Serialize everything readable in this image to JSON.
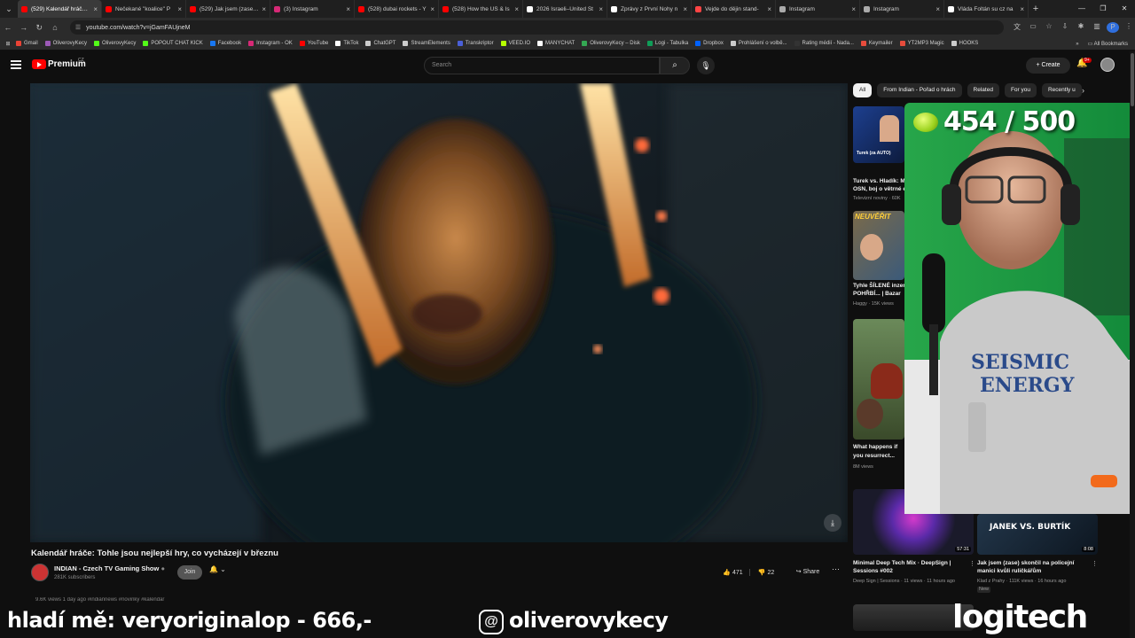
{
  "browser": {
    "tabs": [
      {
        "title": "(529) Kalendář hráče: T",
        "icon": "youtube-icon",
        "color": "#ff0000",
        "active": true
      },
      {
        "title": "Nečekané \"koalice\" P",
        "icon": "youtube-icon",
        "color": "#ff0000"
      },
      {
        "title": "(529) Jak jsem (zase) s",
        "icon": "youtube-icon",
        "color": "#ff0000"
      },
      {
        "title": "(3) Instagram",
        "icon": "instagram-icon",
        "color": "#d62976"
      },
      {
        "title": "(528) dubai rockets - Y",
        "icon": "youtube-icon",
        "color": "#ff0000"
      },
      {
        "title": "(528) How the US & Is",
        "icon": "youtube-icon",
        "color": "#ff0000"
      },
      {
        "title": "2026 Israeli–United St",
        "icon": "wikipedia-icon",
        "color": "#ffffff"
      },
      {
        "title": "Zprávy z První Nohy n",
        "icon": "x-icon",
        "color": "#ffffff"
      },
      {
        "title": "Vejde do dějin stand-",
        "icon": "news-icon",
        "color": "#ff4444"
      },
      {
        "title": "Instagram",
        "icon": "globe-icon",
        "color": "#aaaaaa"
      },
      {
        "title": "Instagram",
        "icon": "globe-icon",
        "color": "#aaaaaa"
      },
      {
        "title": "Vláda Foltán su cz na",
        "icon": "x-icon",
        "color": "#ffffff"
      }
    ],
    "url": "youtube.com/watch?v=jGamFAUjneM",
    "profile_initial": "P",
    "bookmarks": [
      {
        "label": "Gmail",
        "color": "#ea4335"
      },
      {
        "label": "OliverovyKecy",
        "color": "#9b59b6"
      },
      {
        "label": "OliverovyKecy",
        "color": "#53fc18"
      },
      {
        "label": "POPOUT CHAT KICK",
        "color": "#53fc18"
      },
      {
        "label": "Facebook",
        "color": "#1877f2"
      },
      {
        "label": "Instagram - OK",
        "color": "#d62976"
      },
      {
        "label": "YouTube",
        "color": "#ff0000"
      },
      {
        "label": "TikTok",
        "color": "#ffffff"
      },
      {
        "label": "ChatGPT",
        "color": "#cccccc"
      },
      {
        "label": "StreamElements",
        "color": "#cccccc"
      },
      {
        "label": "Transkriptor",
        "color": "#4a5fd8"
      },
      {
        "label": "VEED.IO",
        "color": "#b6ff00"
      },
      {
        "label": "MANYCHAT",
        "color": "#ffffff"
      },
      {
        "label": "OliverovyKecy – Disk",
        "color": "#34a853"
      },
      {
        "label": "Logi - Tabulka",
        "color": "#0f9d58"
      },
      {
        "label": "Dropbox",
        "color": "#0061ff"
      },
      {
        "label": "Prohlášení o volbě...",
        "color": "#cccccc"
      },
      {
        "label": "Rating médií - Nada...",
        "color": "#333333"
      },
      {
        "label": "Keymailer",
        "color": "#e74c3c"
      },
      {
        "label": "YT2MP3 Magic",
        "color": "#e74c3c"
      },
      {
        "label": "HOOKS",
        "color": "#cccccc"
      }
    ],
    "all_bookmarks": "All Bookmarks"
  },
  "masthead": {
    "brand": "Premium",
    "region": "CZ",
    "search_placeholder": "Search",
    "create": "Create",
    "notif_count": "9+"
  },
  "video": {
    "title": "Kalendář hráče: Tohle jsou nejlepší hry, co vycházejí v březnu",
    "channel": "INDIAN - Czech TV Gaming Show",
    "subscribers": "281K subscribers",
    "join": "Join",
    "likes": "471",
    "dislikes": "22",
    "share": "Share",
    "views_line": "9.6K views  1 day ago  #indiannews #novinky #kalendar"
  },
  "sidebar": {
    "chips": [
      "All",
      "From Indian - Pořad o hrách",
      "Related",
      "For you",
      "Recently u"
    ],
    "items": [
      {
        "title": "Turek vs. Hladík: M",
        "title2": "OSN, boj o větrné e",
        "meta": "Televizní noviny · 60K",
        "thumb_text": "Turek (za AUTO)"
      },
      {
        "title": "Tyhle ŠÍLENÉ inzer",
        "title2": "POHŘBÍ... | Bazar",
        "meta": "Haggy · 15K views",
        "thumb_text": "NEUVĚŘIT"
      },
      {
        "title": "What happens if",
        "title2": "you resurrect...",
        "meta": "8M views"
      },
      {
        "title": "Minimal Deep Tech Mix · DeepSign |",
        "title2": "Sessions #002",
        "meta": "Deep Sign | Sessions · 11 views · 11 hours ago",
        "duration": "57:31"
      },
      {
        "title": "Jak jsem (zase) skončil na policejní",
        "title2": "manici kvůli ruličkářům",
        "meta": "Klad z Prahy · 111K views · 16 hours ago",
        "duration": "8:08",
        "thumb_text": "JANEK VS. BURTÍK",
        "badge": "New"
      }
    ]
  },
  "overlay": {
    "counter": "454 / 500",
    "promo_text": "hladí mě: veryoriginalop - 666,-",
    "handle": "oliverovykecy",
    "brand": "logitech"
  }
}
